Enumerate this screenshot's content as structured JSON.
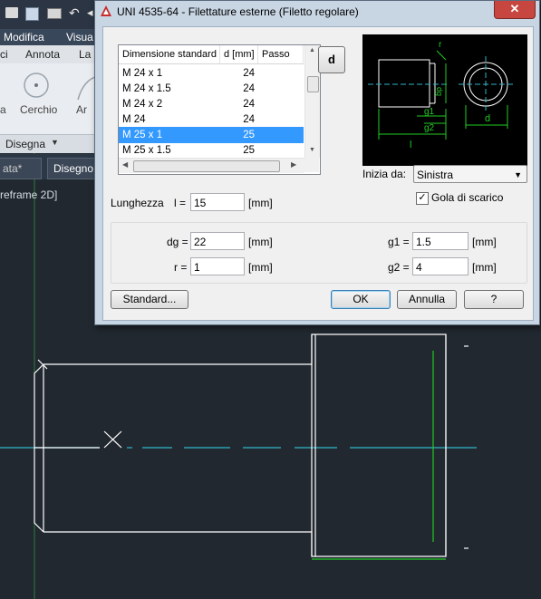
{
  "background": {
    "menubar": [
      "Modifica",
      "Visua"
    ],
    "ribbon_tabs": [
      "ci",
      "Annota",
      "La"
    ],
    "ribbon_tools": [
      "Cerchio",
      "Ar",
      "a"
    ],
    "ribbon_footer": "Disegna",
    "doc_tabs": [
      "ata*",
      "Disegno"
    ],
    "viewport_label": "reframe 2D]"
  },
  "dialog": {
    "title": "UNI 4535-64 - Filettature esterne  (Filetto regolare)",
    "close_label": "✕",
    "list": {
      "columns": [
        "Dimensione standard",
        "d [mm]",
        "Passo"
      ],
      "rows": [
        {
          "name": "M 24 x 1",
          "d": "24",
          "selected": false
        },
        {
          "name": "M 24 x 1.5",
          "d": "24",
          "selected": false
        },
        {
          "name": "M 24 x 2",
          "d": "24",
          "selected": false
        },
        {
          "name": "M 24",
          "d": "24",
          "selected": false
        },
        {
          "name": "M 25 x 1",
          "d": "25",
          "selected": true
        },
        {
          "name": "M 25 x 1.5",
          "d": "25",
          "selected": false
        }
      ]
    },
    "d_button_label": "d",
    "preview_labels": {
      "r": "r",
      "dg": "dg",
      "g1": "g1",
      "g2": "g2",
      "d": "d",
      "l": "l"
    },
    "inizia_da": {
      "label": "Inizia da:",
      "value": "Sinistra"
    },
    "gola": {
      "label": "Gola di scarico",
      "checked": true
    },
    "lunghezza": {
      "label": "Lunghezza",
      "symbol": "l =",
      "value": "15",
      "unit": "[mm]"
    },
    "params": {
      "dg": {
        "label": "dg =",
        "value": "22",
        "unit": "[mm]"
      },
      "r": {
        "label": "r =",
        "value": "1",
        "unit": "[mm]"
      },
      "g1": {
        "label": "g1 =",
        "value": "1.5",
        "unit": "[mm]"
      },
      "g2": {
        "label": "g2 =",
        "value": "4",
        "unit": "[mm]"
      }
    },
    "buttons": {
      "standard": "Standard...",
      "ok": "OK",
      "annulla": "Annulla",
      "help": "?"
    }
  },
  "colors": {
    "canvas": "#212830",
    "geometry": "#ffffff",
    "axis": "#2fb4c8",
    "green": "#22cc22",
    "selection": "#3399ff"
  }
}
